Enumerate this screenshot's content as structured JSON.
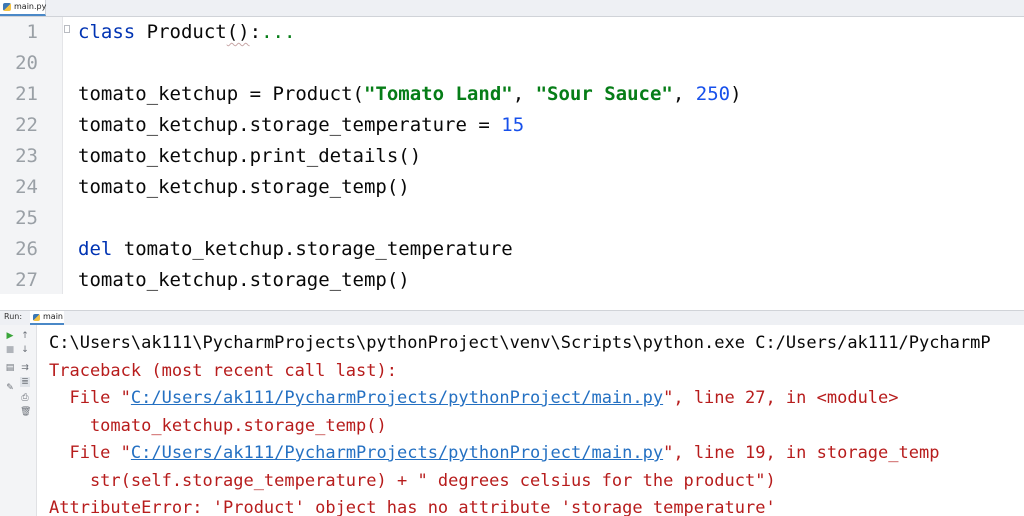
{
  "editor_tab": {
    "label": "main.py",
    "icon": "python-file-icon"
  },
  "editor": {
    "lines": [
      {
        "num": "1",
        "parts": [
          {
            "t": "class",
            "c": "kw"
          },
          {
            "t": " Product",
            "c": ""
          },
          {
            "t": "()",
            "c": "squiggle"
          },
          {
            "t": ":",
            "c": ""
          },
          {
            "t": "...",
            "c": "ellipsis"
          }
        ]
      },
      {
        "num": "20",
        "parts": []
      },
      {
        "num": "21",
        "parts": [
          {
            "t": "tomato_ketchup = Product(",
            "c": ""
          },
          {
            "t": "\"Tomato Land\"",
            "c": "str"
          },
          {
            "t": ", ",
            "c": ""
          },
          {
            "t": "\"Sour Sauce\"",
            "c": "str"
          },
          {
            "t": ", ",
            "c": ""
          },
          {
            "t": "250",
            "c": "num"
          },
          {
            "t": ")",
            "c": ""
          }
        ]
      },
      {
        "num": "22",
        "parts": [
          {
            "t": "tomato_ketchup.storage_temperature = ",
            "c": ""
          },
          {
            "t": "15",
            "c": "num"
          }
        ]
      },
      {
        "num": "23",
        "parts": [
          {
            "t": "tomato_ketchup.print_details()",
            "c": ""
          }
        ]
      },
      {
        "num": "24",
        "parts": [
          {
            "t": "tomato_ketchup.storage_temp()",
            "c": ""
          }
        ]
      },
      {
        "num": "25",
        "parts": []
      },
      {
        "num": "26",
        "parts": [
          {
            "t": "del",
            "c": "kw"
          },
          {
            "t": " tomato_ketchup.storage_temperature",
            "c": ""
          }
        ]
      },
      {
        "num": "27",
        "parts": [
          {
            "t": "tomato_ketchup.storage_temp()",
            "c": ""
          }
        ]
      }
    ]
  },
  "run_panel": {
    "label": "Run:",
    "tab_label": "main",
    "toolbar_icons": [
      "rerun-icon",
      "scroll-up-icon",
      "stop-icon",
      "scroll-down-icon",
      "layout-icon",
      "soft-wrap-icon",
      "pin-icon",
      "print-icon",
      "trash-icon"
    ]
  },
  "console": {
    "lines": [
      {
        "kind": "plain",
        "parts": [
          {
            "t": "C:\\Users\\ak111\\PycharmProjects\\pythonProject\\venv\\Scripts\\python.exe C:/Users/ak111/PycharmP"
          }
        ]
      },
      {
        "kind": "err",
        "parts": [
          {
            "t": "Traceback (most recent call last):"
          }
        ]
      },
      {
        "kind": "err",
        "parts": [
          {
            "t": "  File \""
          },
          {
            "t": "C:/Users/ak111/PycharmProjects/pythonProject/main.py",
            "link": true
          },
          {
            "t": "\", line 27, in <module>"
          }
        ]
      },
      {
        "kind": "err",
        "parts": [
          {
            "t": "    tomato_ketchup.storage_temp()"
          }
        ]
      },
      {
        "kind": "err",
        "parts": [
          {
            "t": "  File \""
          },
          {
            "t": "C:/Users/ak111/PycharmProjects/pythonProject/main.py",
            "link": true
          },
          {
            "t": "\", line 19, in storage_temp"
          }
        ]
      },
      {
        "kind": "err",
        "parts": [
          {
            "t": "    str(self.storage_temperature) + \" degrees celsius for the product\")"
          }
        ]
      },
      {
        "kind": "err",
        "parts": [
          {
            "t": "AttributeError: 'Product' object has no attribute 'storage_temperature'"
          }
        ]
      }
    ]
  },
  "colors": {
    "keyword": "#0033b3",
    "string": "#067d17",
    "number": "#1750eb",
    "error_text": "#b71c1c",
    "link": "#2470c2"
  }
}
